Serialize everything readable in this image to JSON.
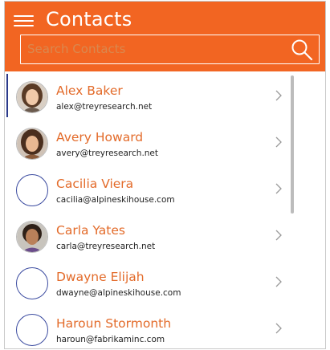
{
  "header": {
    "title": "Contacts",
    "menu_icon": "hamburger-menu-icon",
    "accent_color": "#f26522"
  },
  "search": {
    "placeholder": "Search Contacts",
    "value": "",
    "icon": "search-icon"
  },
  "contacts": [
    {
      "name": "Alex Baker",
      "email": "alex@treyresearch.net",
      "has_photo": true,
      "selected": true
    },
    {
      "name": "Avery Howard",
      "email": "avery@treyresearch.net",
      "has_photo": true,
      "selected": false
    },
    {
      "name": "Cacilia Viera",
      "email": "cacilia@alpineskihouse.com",
      "has_photo": false,
      "selected": false
    },
    {
      "name": "Carla Yates",
      "email": "carla@treyresearch.net",
      "has_photo": true,
      "selected": false
    },
    {
      "name": "Dwayne Elijah",
      "email": "dwayne@alpineskihouse.com",
      "has_photo": false,
      "selected": false
    },
    {
      "name": "Haroun Stormonth",
      "email": "haroun@fabrikaminc.com",
      "has_photo": false,
      "selected": false
    }
  ],
  "colors": {
    "name_text": "#e36b2a",
    "email_text": "#222222",
    "avatar_border": "#3b4ba0",
    "selection_bar": "#2b3a8b"
  }
}
